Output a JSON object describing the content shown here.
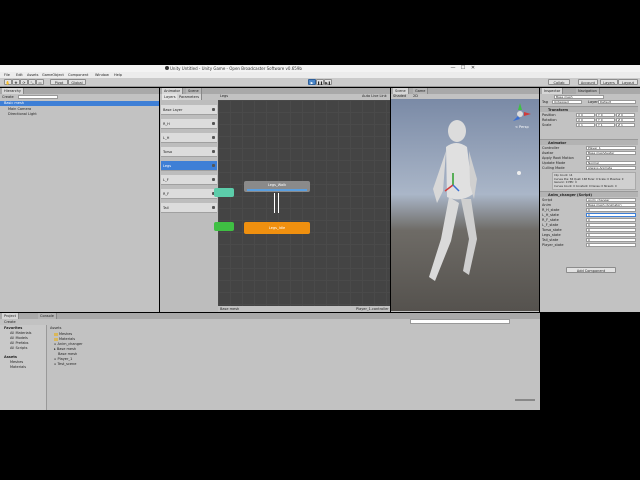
{
  "window": {
    "title": "Unity Untitled - Unity Game - Open Broadcaster Software v0.659b",
    "controls": [
      "—",
      "☐",
      "✕"
    ]
  },
  "menu": [
    "File",
    "Edit",
    "Assets",
    "GameObject",
    "Component",
    "Window",
    "Help"
  ],
  "toolbar": {
    "tools": [
      "✋",
      "✥",
      "⟳",
      "⤡",
      "▭"
    ],
    "pivot": "Pivot",
    "global": "Global",
    "play": "▶",
    "pause": "❚❚",
    "step": "▶❚",
    "collab": "Collab",
    "account": "Account",
    "layers": "Layers",
    "layout": "Layout"
  },
  "hierarchy": {
    "tab": "Hierarchy",
    "create": "Create",
    "scene": "Basic mesh",
    "items": [
      "Main Camera",
      "Directional Light"
    ]
  },
  "animator": {
    "tabs": [
      "Animator",
      "Scene"
    ],
    "subtabs": [
      "Layers",
      "Parameters"
    ],
    "breadcrumb": "Legs",
    "autolive": "Auto Live Link",
    "layers": [
      "Base Layer",
      "R_H",
      "L_H",
      "Torso",
      "Legs",
      "L_F",
      "R_F",
      "Tail"
    ],
    "selected_layer": 4,
    "nodes": [
      "Legs_Walk",
      "Legs_Idle"
    ],
    "status_left": "Base mesh",
    "status_right": "Player_1.controller"
  },
  "scene": {
    "tabs": [
      "Scene",
      "Game"
    ],
    "shading": "Shaded",
    "mode": "2D",
    "persp": "< Persp"
  },
  "inspector": {
    "tabs": [
      "Inspector",
      "Navigation"
    ],
    "object_name": "Base mesh",
    "tag_label": "Tag",
    "tag": "Untagged",
    "layer_label": "Layer",
    "layer": "Default",
    "transform": {
      "title": "Transform",
      "rows": [
        {
          "label": "Position",
          "x": "X 0",
          "y": "Y 0",
          "z": "Z 0"
        },
        {
          "label": "Rotation",
          "x": "X 0",
          "y": "Y 0",
          "z": "Z 0"
        },
        {
          "label": "Scale",
          "x": "X 1",
          "y": "Y 1",
          "z": "Z 1"
        }
      ]
    },
    "animator": {
      "title": "Animator",
      "rows": [
        {
          "label": "Controller",
          "value": "Player_1"
        },
        {
          "label": "Avatar",
          "value": "Base meshAvatar"
        },
        {
          "label": "Apply Root Motion",
          "value": ""
        },
        {
          "label": "Update Mode",
          "value": "Normal"
        },
        {
          "label": "Culling Mode",
          "value": "Always Animate"
        }
      ],
      "info": [
        "Clip Count: 14",
        "Curves Pos: 84 Quat: 168 Euler: 0 Scale: 0 Muscles: 0 Generic: 0 PPtr: 0",
        "Curves Count: 0 Constant: 0 Dense: 0 Stream: 0"
      ]
    },
    "script": {
      "title": "Anim_changer (Script)",
      "rows": [
        {
          "label": "Script",
          "value": "Anim_changer"
        },
        {
          "label": "Anim",
          "value": "Base mesh (Animator)"
        },
        {
          "label": "R_H_state",
          "value": "0"
        },
        {
          "label": "L_H_state",
          "value": "0"
        },
        {
          "label": "R_F_state",
          "value": "0"
        },
        {
          "label": "L_F_state",
          "value": "0"
        },
        {
          "label": "Torso_state",
          "value": "0"
        },
        {
          "label": "Legs_state",
          "value": "0"
        },
        {
          "label": "Tail_state",
          "value": "0"
        },
        {
          "label": "Player_state",
          "value": "0"
        }
      ]
    },
    "add_component": "Add Component"
  },
  "project": {
    "tabs": [
      "Project",
      "Console"
    ],
    "create": "Create",
    "favorites": {
      "label": "Favorites",
      "items": [
        "All Materials",
        "All Models",
        "All Prefabs",
        "All Scripts"
      ]
    },
    "assets_tree": {
      "label": "Assets",
      "items": [
        "Meshes",
        "Materials"
      ]
    },
    "breadcrumb": "Assets",
    "files": [
      "Meshes",
      "Materials",
      "Anim_changer",
      "Base mesh",
      "Base mesh",
      "Player_1",
      "Test_scene"
    ]
  },
  "colors": {
    "accent": "#3e7fd6",
    "node_orange": "#f0900f",
    "node_gray": "#8a8a8a",
    "entry_teal": "#5ccdaa",
    "entry_green": "#3fc043"
  }
}
